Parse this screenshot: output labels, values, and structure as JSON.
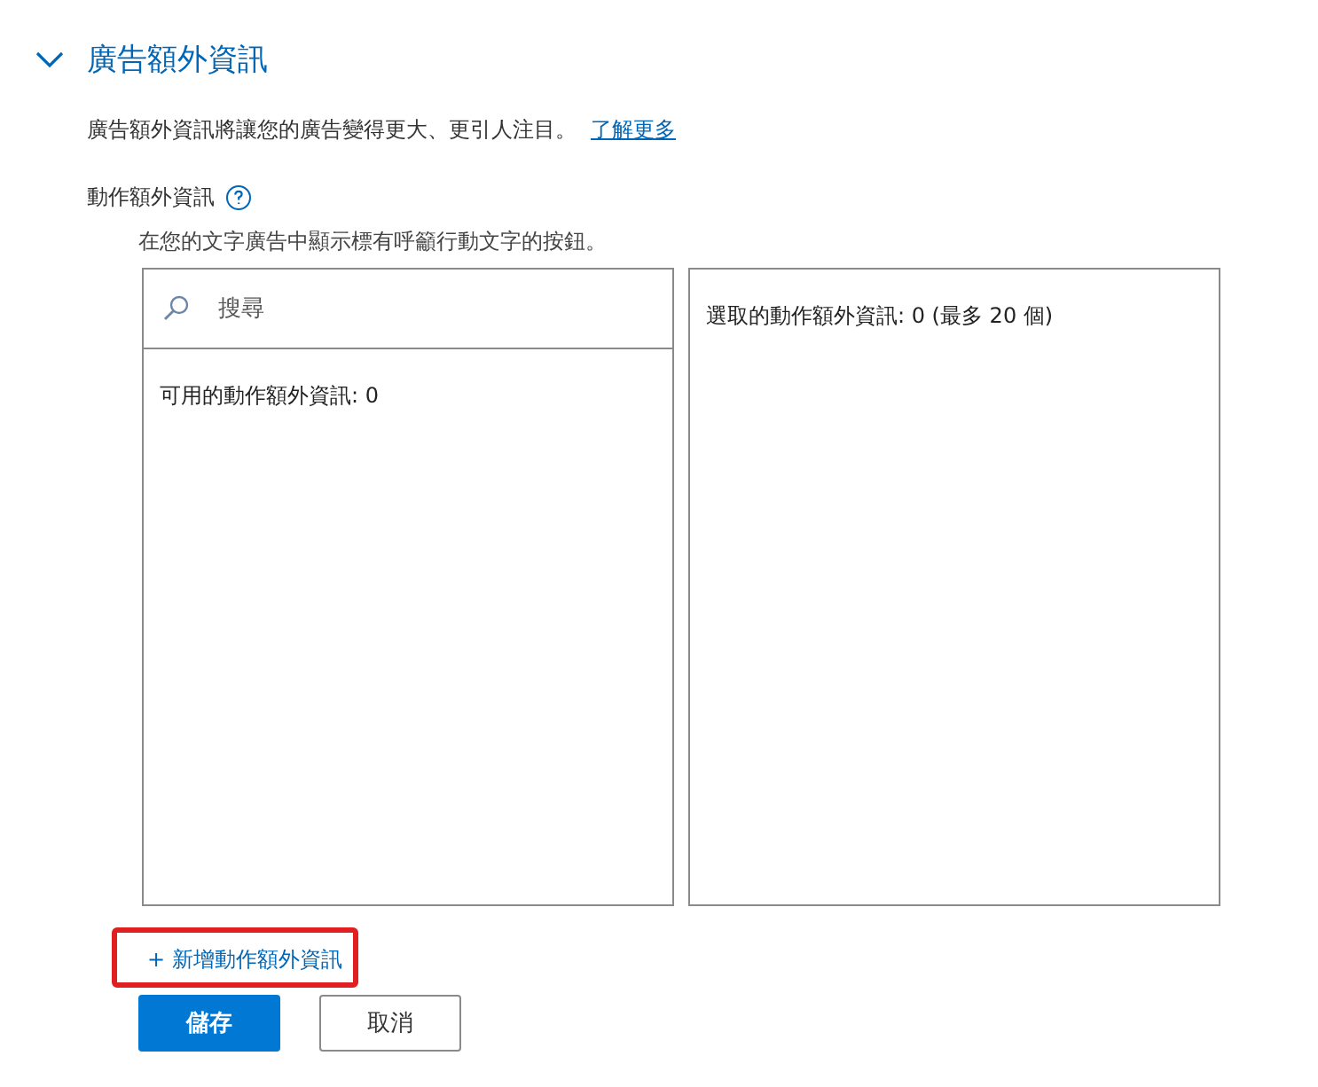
{
  "section": {
    "title": "廣告額外資訊",
    "expanded": true,
    "description": "廣告額外資訊將讓您的廣告變得更大、更引人注目。",
    "learn_more": "了解更多"
  },
  "field": {
    "label": "動作額外資訊",
    "hint": "在您的文字廣告中顯示標有呼籲行動文字的按鈕。"
  },
  "available_panel": {
    "search": {
      "placeholder": "搜尋"
    },
    "count_label": "可用的動作額外資訊: 0"
  },
  "selected_panel": {
    "count_label": "選取的動作額外資訊: 0 (最多 20 個)"
  },
  "add_link": {
    "label": "+ 新增動作額外資訊",
    "highlighted": true
  },
  "buttons": [
    {
      "label": "儲存",
      "kind": "primary"
    },
    {
      "label": "取消",
      "kind": "secondary"
    }
  ]
}
